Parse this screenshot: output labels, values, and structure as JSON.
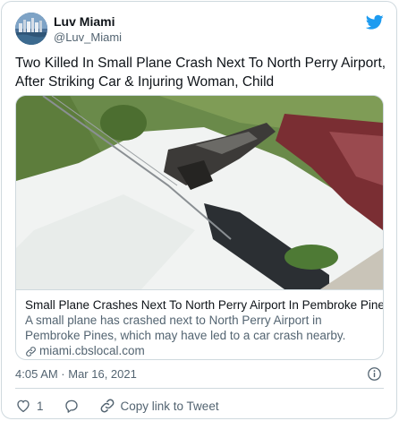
{
  "author": {
    "display_name": "Luv Miami",
    "handle": "@Luv_Miami",
    "avatar_icon": "miami-skyline-avatar",
    "brand_icon": "twitter-bird-icon",
    "brand_color": "#1d9bf0"
  },
  "tweet": {
    "text": "Two Killed In Small Plane Crash Next To North Perry Airport, After Striking Car & Injuring Woman, Child",
    "timestamp": "4:05 AM · Mar 16, 2021"
  },
  "card": {
    "title": "Small Plane Crashes Next To North Perry Airport In Pembroke Pines",
    "description": "A small plane has crashed next to North Perry Airport in Pembroke Pines, which may have led to a car crash nearby.",
    "domain": "miami.cbslocal.com",
    "link_icon": "link-icon"
  },
  "actions": {
    "like_count": "1",
    "like_icon": "heart-icon",
    "reply_icon": "reply-icon",
    "copy_label": "Copy link to Tweet",
    "copy_icon": "copy-link-icon"
  },
  "colors": {
    "text": "#0f1419",
    "secondary": "#536471",
    "border": "#cfd9de"
  }
}
